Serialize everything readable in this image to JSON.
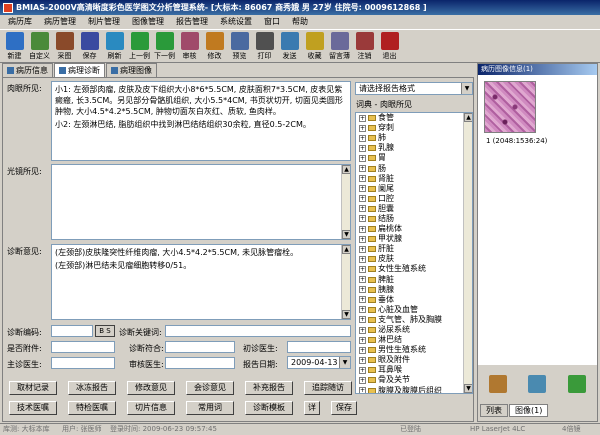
{
  "window": {
    "title": "BMIAS-2000V高清晰度彩色医学图文分析管理系统",
    "patient_info": "- [大标本: 86067  商秀娥  男  27岁  住院号: 0009612868 ]"
  },
  "menu": [
    "病历库",
    "病历管理",
    "制片管理",
    "图像管理",
    "报告管理",
    "系统设置",
    "窗口",
    "帮助"
  ],
  "toolbar": [
    {
      "label": "新建",
      "icon": "new-file-icon",
      "color": "#2e6fc4"
    },
    {
      "label": "自定义",
      "icon": "custom-icon",
      "color": "#4a8a3a"
    },
    {
      "label": "采图",
      "icon": "capture-icon",
      "color": "#8a4a2a"
    },
    {
      "label": "保存",
      "icon": "save-icon",
      "color": "#3a4aa0"
    },
    {
      "label": "刷新",
      "icon": "refresh-icon",
      "color": "#2a8ac0"
    },
    {
      "label": "上一例",
      "icon": "previous-icon",
      "color": "#2a9a3a"
    },
    {
      "label": "下一例",
      "icon": "next-icon",
      "color": "#2a9a3a"
    },
    {
      "label": "审核",
      "icon": "approve-icon",
      "color": "#a04a6a"
    },
    {
      "label": "修改",
      "icon": "edit-icon",
      "color": "#c07a20"
    },
    {
      "label": "预览",
      "icon": "preview-icon",
      "color": "#4a6aa0"
    },
    {
      "label": "打印",
      "icon": "print-icon",
      "color": "#505050"
    },
    {
      "label": "发送",
      "icon": "send-icon",
      "color": "#3a7ab0"
    },
    {
      "label": "收藏",
      "icon": "favorite-icon",
      "color": "#c0a020"
    },
    {
      "label": "留言薄",
      "icon": "message-icon",
      "color": "#6a6a9a"
    },
    {
      "label": "注销",
      "icon": "logout-icon",
      "color": "#9a3a3a"
    },
    {
      "label": "退出",
      "icon": "exit-icon",
      "color": "#b02020"
    }
  ],
  "tabs": [
    "病历信息",
    "病理诊断",
    "病理图像"
  ],
  "form": {
    "gross_label": "肉眼所见:",
    "gross_text": [
      "小1: 左颈部肉瘤, 皮肤及皮下组织大小8*6*5.5CM, 皮肤面积7*3.5CM, 皮表见紫癜瘢, 长3.5CM。另见部分骨骼肌组织, 大小5.5*4CM, 书页状切开, 切面见类圆形肿物, 大小4.5*4.2*5.5CM, 肿物切面灰白灰红、质软, 鱼肉样。",
      "小2: 左颈淋巴结, 脂肪组织中找到淋巴结结组织30余粒, 直径0.5-2CM。"
    ],
    "micro_label": "光镜所见:",
    "micro_text": "",
    "diag_label": "诊断意见:",
    "diag_text": [
      "(左颈部)皮肤隆突性纤维肉瘤, 大小4.5*4.2*5.5CM, 未见脉管瘤栓。",
      "(左颈部)淋巴结未见瘤细胞转移0/51。"
    ],
    "code_label": "诊断编码:",
    "keyword_label": "诊断关键词:",
    "attached_label": "是否附件:",
    "match_label": "诊断符合:",
    "first_doctor_label": "初诊医生:",
    "attending_label": "主诊医生:",
    "reviewer_label": "审核医生:",
    "report_date_label": "报告日期:",
    "report_date": "2009-04-13",
    "small_btn_label": "B S"
  },
  "report_format": {
    "placeholder": "请选择报告格式",
    "dict_title": "词典 - 肉眼所见",
    "items": [
      "食管",
      "穿刺",
      "肺",
      "乳腺",
      "胃",
      "肠",
      "肾脏",
      "阑尾",
      "口腔",
      "胆囊",
      "结肠",
      "扁桃体",
      "甲状腺",
      "肝脏",
      "皮肤",
      "女性生殖系统",
      "脾脏",
      "胰腺",
      "垂体",
      "心脏及血管",
      "支气管、肺及胸膜",
      "泌尿系统",
      "淋巴结",
      "男性生殖系统",
      "眼及附件",
      "耳鼻喉",
      "骨及关节",
      "腹膜及腹膜后组织"
    ]
  },
  "buttons_row1": [
    "取材记录",
    "冰冻报告",
    "修改意见",
    "会诊意见",
    "补充报告",
    "追踪随访"
  ],
  "buttons_row2": [
    "技术医嘱",
    "特检医嘱",
    "切片信息",
    "常用词",
    "诊断模板",
    "详",
    "保存"
  ],
  "image_panel": {
    "header": "病历图像信息(1)",
    "caption": "1 (2048:1536:24)",
    "tabs": [
      "列表",
      "图像(1)"
    ]
  },
  "status": {
    "db": "库测: 大标本库",
    "user": "用户: 张医师",
    "login": "登录时间: 2009-06-23 09:57:45",
    "state": "已登陆",
    "printer": "HP LaserJet 4LC",
    "zoom": "4倍镜"
  }
}
